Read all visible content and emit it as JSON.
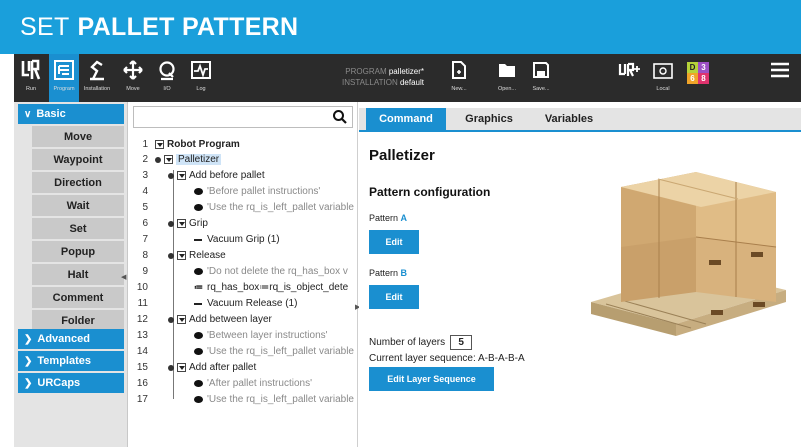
{
  "banner": {
    "light": "SET",
    "bold": "PALLET PATTERN"
  },
  "topbar": {
    "buttons": [
      {
        "label": "Run",
        "icon": "ur-logo-icon"
      },
      {
        "label": "Program",
        "icon": "program-icon"
      },
      {
        "label": "Installation",
        "icon": "installation-icon"
      },
      {
        "label": "Move",
        "icon": "move-icon"
      },
      {
        "label": "I/O",
        "icon": "io-icon"
      },
      {
        "label": "Log",
        "icon": "log-icon"
      }
    ],
    "program_label": "PROGRAM",
    "program_value": "palletizer*",
    "installation_label": "INSTALLATION",
    "installation_value": "default",
    "file_buttons": [
      {
        "label": "New...",
        "icon": "new-file-icon"
      },
      {
        "label": "Open...",
        "icon": "folder-icon"
      },
      {
        "label": "Save...",
        "icon": "save-icon"
      }
    ],
    "local_label": "Local",
    "dots": [
      "D",
      "3",
      "6",
      "8"
    ],
    "colors": {
      "accent": "#1a8fd0",
      "bar": "#2b2b2b",
      "dots": [
        "#b6d33a",
        "#9d4fc4",
        "#f0a429",
        "#e0336e"
      ]
    }
  },
  "sidebar": {
    "categories": [
      {
        "label": "Basic",
        "expanded": true
      },
      {
        "label": "Advanced",
        "expanded": false
      },
      {
        "label": "Templates",
        "expanded": false
      },
      {
        "label": "URCaps",
        "expanded": false
      }
    ],
    "basic_items": [
      "Move",
      "Waypoint",
      "Direction",
      "Wait",
      "Set",
      "Popup",
      "Halt",
      "Comment",
      "Folder"
    ]
  },
  "tree": {
    "search_placeholder": "",
    "lines": [
      {
        "num": "1",
        "text": "Robot Program",
        "kind": "root"
      },
      {
        "num": "2",
        "text": "Palletizer",
        "kind": "node"
      },
      {
        "num": "3",
        "text": "Add before pallet",
        "kind": "node"
      },
      {
        "num": "4",
        "text": "'Before pallet instructions'",
        "kind": "comment"
      },
      {
        "num": "5",
        "text": "'Use the rq_is_left_pallet variable",
        "kind": "comment"
      },
      {
        "num": "6",
        "text": "Grip",
        "kind": "node"
      },
      {
        "num": "7",
        "text": "Vacuum Grip  (1)",
        "kind": "cmd"
      },
      {
        "num": "8",
        "text": "Release",
        "kind": "node"
      },
      {
        "num": "9",
        "text": "'Do not delete the rq_has_box v",
        "kind": "comment"
      },
      {
        "num": "10",
        "text": "rq_has_box≔rq_is_object_dete",
        "kind": "assign"
      },
      {
        "num": "11",
        "text": "Vacuum Release  (1)",
        "kind": "cmd"
      },
      {
        "num": "12",
        "text": "Add between layer",
        "kind": "node"
      },
      {
        "num": "13",
        "text": "'Between layer instructions'",
        "kind": "comment"
      },
      {
        "num": "14",
        "text": "'Use the rq_is_left_pallet variable",
        "kind": "comment"
      },
      {
        "num": "15",
        "text": "Add after pallet",
        "kind": "node"
      },
      {
        "num": "16",
        "text": "'After pallet instructions'",
        "kind": "comment"
      },
      {
        "num": "17",
        "text": "'Use the rq_is_left_pallet variable",
        "kind": "comment"
      }
    ]
  },
  "panel": {
    "tabs": [
      "Command",
      "Graphics",
      "Variables"
    ],
    "active_tab": "Command",
    "title": "Palletizer",
    "section": "Pattern configuration",
    "pattern_a_label": "Pattern",
    "pattern_a_letter": "A",
    "pattern_b_label": "Pattern",
    "pattern_b_letter": "B",
    "edit_label": "Edit",
    "layers_label": "Number of layers",
    "layers_value": "5",
    "sequence_label": "Current layer sequence: A-B-A-B-A",
    "edit_sequence_label": "Edit Layer Sequence"
  }
}
